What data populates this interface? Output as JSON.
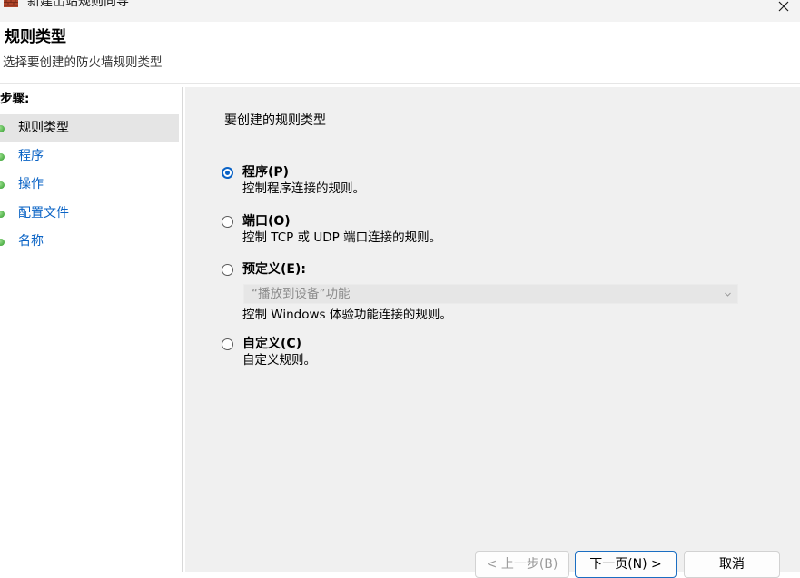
{
  "window": {
    "title": "新建出站规则向导",
    "app_icon": "firewall-icon",
    "close_icon": "close-icon"
  },
  "header": {
    "title": "规则类型",
    "subtitle": "选择要创建的防火墙规则类型"
  },
  "steps": {
    "heading": "步骤:",
    "items": [
      {
        "label": "规则类型",
        "active": true
      },
      {
        "label": "程序",
        "active": false
      },
      {
        "label": "操作",
        "active": false
      },
      {
        "label": "配置文件",
        "active": false
      },
      {
        "label": "名称",
        "active": false
      }
    ],
    "dot_color": "#2e9a2a"
  },
  "content": {
    "prompt": "要创建的规则类型",
    "options": [
      {
        "label": "程序(P)",
        "description": "控制程序连接的规则。",
        "selected": true
      },
      {
        "label": "端口(O)",
        "description": "控制 TCP 或 UDP 端口连接的规则。",
        "selected": false
      },
      {
        "label": "预定义(E):",
        "description": "控制 Windows 体验功能连接的规则。",
        "selected": false
      },
      {
        "label": "自定义(C)",
        "description": "自定义规则。",
        "selected": false
      }
    ],
    "predefined_dropdown": {
      "value": "“播放到设备”功能",
      "disabled": true
    }
  },
  "buttons": {
    "back": "< 上一步(B)",
    "next": "下一页(N) >",
    "cancel": "取消"
  },
  "colors": {
    "accent": "#0b63c6",
    "link": "#0a63c5",
    "content_bg": "#f0f0f0"
  }
}
